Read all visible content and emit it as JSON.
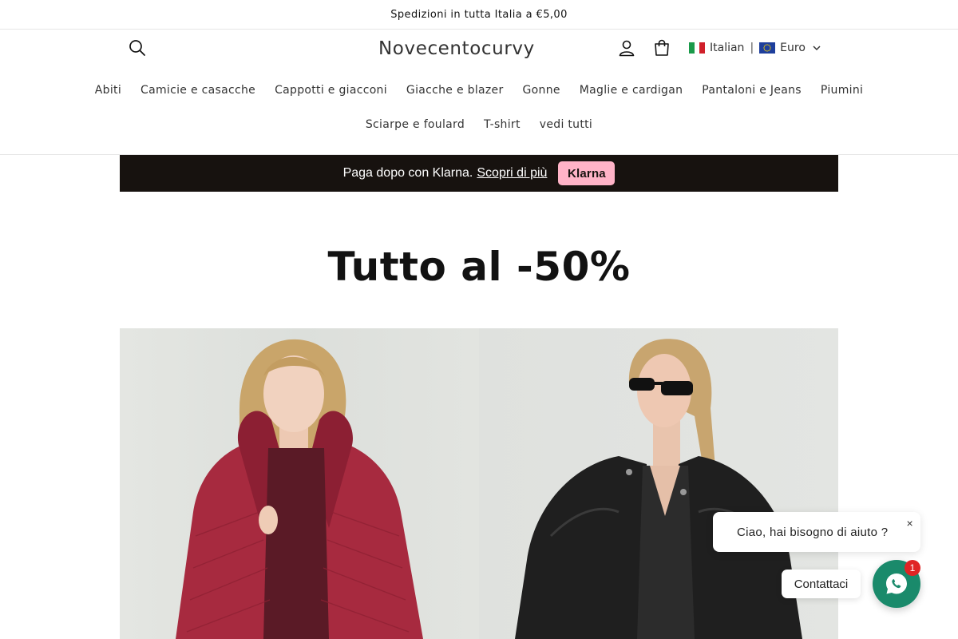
{
  "announcement": {
    "text": "Spedizioni in tutta Italia a €5,00"
  },
  "header": {
    "logo": "Novecentocurvy",
    "icons": {
      "search": "search-icon",
      "account": "user-icon",
      "cart": "shopping-bag-icon"
    },
    "language": "Italian",
    "separator": "|",
    "currency": "Euro"
  },
  "nav": {
    "row1": [
      "Abiti",
      "Camicie e casacche",
      "Cappotti e giacconi",
      "Giacche e blazer",
      "Gonne",
      "Maglie e cardigan",
      "Pantaloni e Jeans",
      "Piumini"
    ],
    "row2": [
      "Sciarpe e foulard",
      "T-shirt",
      "vedi tutti"
    ]
  },
  "klarna": {
    "text": "Paga dopo con Klarna.",
    "link": "Scopri di più",
    "badge": "Klarna",
    "bg": "#17120f",
    "badge_color": "#ffb3c7"
  },
  "page": {
    "title": "Tutto al -50%"
  },
  "hero": {
    "left_image": "woman in burgundy quilted puffer jacket",
    "right_image": "woman in black leather jacket and sunglasses"
  },
  "chat": {
    "bubble_text": "Ciao, hai bisogno di aiuto ?",
    "close": "×",
    "contact_label": "Contattaci",
    "badge_count": "1",
    "button_icon": "whatsapp-icon",
    "accent": "#1a8a6b"
  }
}
